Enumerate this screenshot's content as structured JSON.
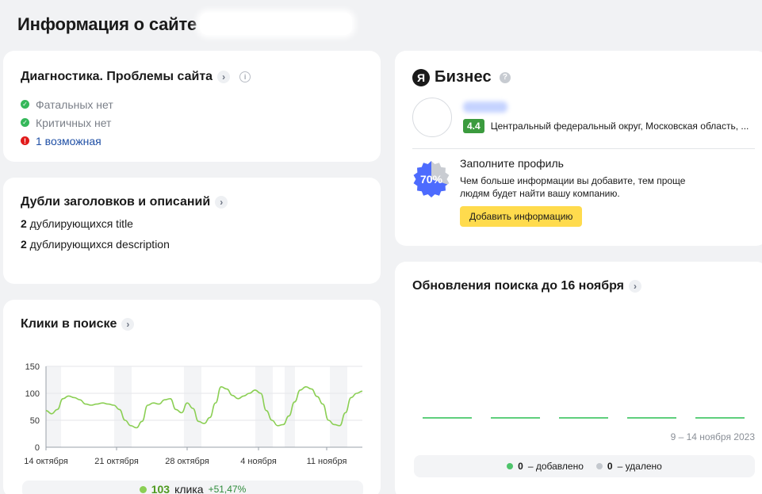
{
  "page": {
    "title": "Информация о сайте"
  },
  "diagnostics": {
    "title": "Диагностика. Проблемы сайта",
    "items": [
      {
        "label": "Фатальных нет",
        "status": "ok"
      },
      {
        "label": "Критичных нет",
        "status": "ok"
      },
      {
        "label": "1 возможная",
        "status": "warning"
      }
    ]
  },
  "duplicates": {
    "title": "Дубли заголовков и описаний",
    "rows": [
      {
        "count": "2",
        "text": " дублирующихся title"
      },
      {
        "count": "2",
        "text": " дублирующихся description"
      }
    ]
  },
  "clicks": {
    "title": "Клики в поиске",
    "summary": {
      "count": "103",
      "unit": "клика",
      "delta": "+51,47%"
    }
  },
  "business": {
    "brand_letter": "Я",
    "brand_word": "Бизнес",
    "rating": "4.4",
    "address": "Центральный федеральный округ, Московская область, ...",
    "profile_title": "Заполните профиль",
    "profile_desc_1": "Чем больше информации вы добавите, тем проще",
    "profile_desc_2": "людям будет найти вашу компанию.",
    "profile_percent": "70%",
    "profile_fill": 0.7,
    "add_button": "Добавить информацию"
  },
  "updates": {
    "title": "Обновления поиска до 16 ноября",
    "date_range": "9 – 14 ноября 2023",
    "legend": [
      {
        "count": "0",
        "label": " – добавлено",
        "color": "#4ec46b"
      },
      {
        "count": "0",
        "label": " – удалено",
        "color": "#c4c8ce"
      }
    ]
  },
  "chart_data": {
    "type": "line",
    "ylim": [
      0,
      150
    ],
    "yticks": [
      0,
      50,
      100,
      150
    ],
    "x_ticks": [
      "14 октября",
      "21 октября",
      "28 октября",
      "4 ноября",
      "11 ноября"
    ],
    "color": "#8bcf54",
    "series": [
      {
        "values": [
          68,
          62,
          70,
          90,
          95,
          92,
          88,
          80,
          78,
          80,
          82,
          80,
          78,
          70,
          50,
          40,
          36,
          48,
          78,
          82,
          80,
          88,
          90,
          70,
          64,
          82,
          72,
          48,
          44,
          55,
          82,
          112,
          108,
          96,
          90,
          95,
          100,
          106,
          100,
          68,
          50,
          40,
          42,
          58,
          84,
          106,
          112,
          108,
          94,
          80,
          50,
          42,
          40,
          64,
          92,
          100,
          104
        ]
      }
    ]
  }
}
